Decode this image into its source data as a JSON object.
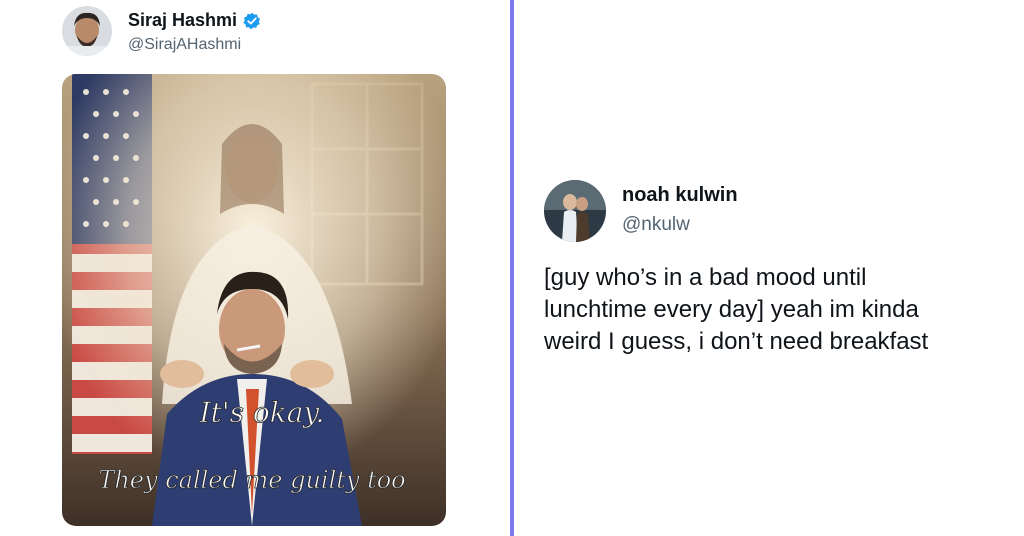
{
  "colors": {
    "divider": "#7b78f0",
    "verified": "#1d9bf0",
    "handle": "#536471",
    "text": "#0f1419"
  },
  "left_tweet": {
    "display_name": "Siraj Hashmi",
    "handle": "@SirajAHashmi",
    "verified_icon": "verified-badge-icon",
    "image": {
      "caption_line1": "It's okay.",
      "caption_line2": "They called me guilty too"
    }
  },
  "right_tweet": {
    "display_name": "noah kulwin",
    "handle": "@nkulw",
    "text_lines": [
      "[guy who’s in a bad mood until",
      "lunchtime every day] yeah im kinda",
      "weird I guess, i don’t need breakfast"
    ]
  }
}
